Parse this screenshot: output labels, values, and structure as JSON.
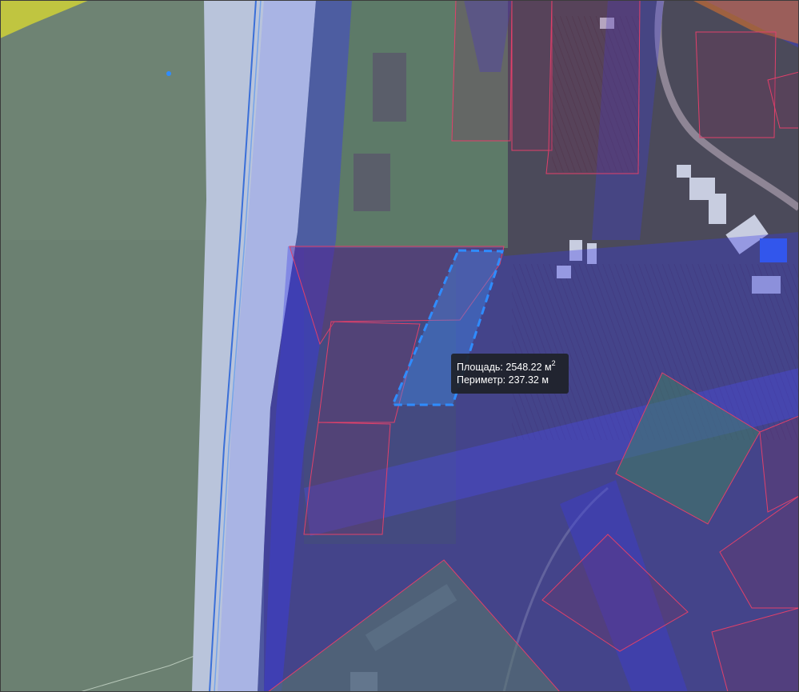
{
  "measurement": {
    "area_label": "Площадь:",
    "area_value": "2548.22",
    "area_unit": "м",
    "area_exponent": "2",
    "perimeter_label": "Периметр:",
    "perimeter_value": "237.32",
    "perimeter_unit": "м"
  },
  "colors": {
    "parcel_outline": "#e0406a",
    "zone_fill": "#3a3ae6",
    "measure_outline": "#2f8cff",
    "road_fill": "#b7c2dc",
    "river_fill": "#aab6e6",
    "field_fill": "#6f8474",
    "highlight_fill": "#d4d63a"
  }
}
